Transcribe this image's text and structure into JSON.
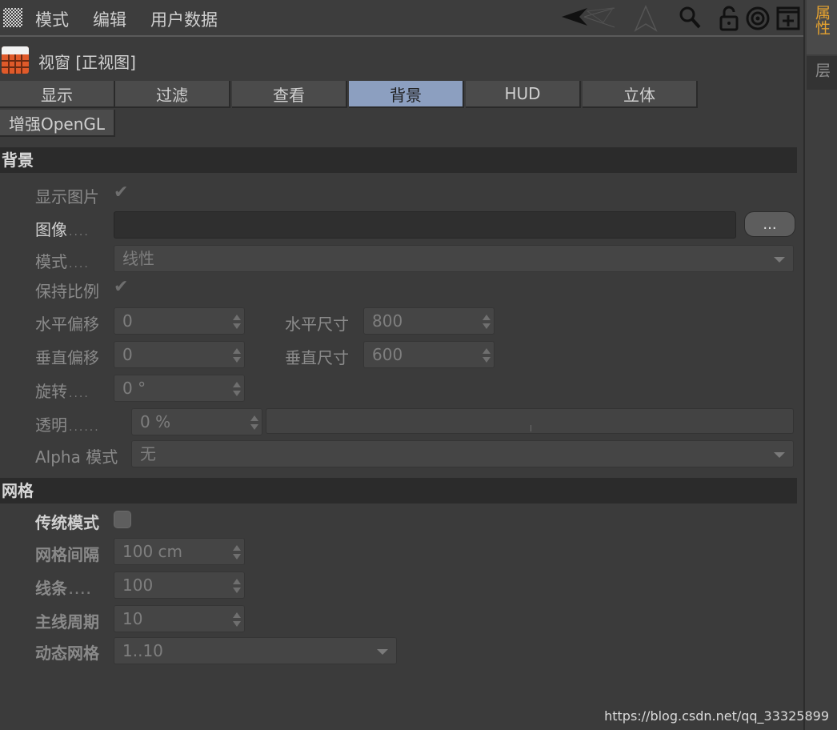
{
  "menu": {
    "items": [
      "模式",
      "编辑",
      "用户数据"
    ]
  },
  "toolbar": {
    "icons": [
      "arrow-back-icon",
      "arrow-up-icon",
      "search-icon",
      "lock-icon",
      "target-icon",
      "add-panel-icon"
    ]
  },
  "title": {
    "text": "视窗 [正视图]"
  },
  "tabs": [
    {
      "label": "显示"
    },
    {
      "label": "过滤"
    },
    {
      "label": "查看"
    },
    {
      "label": "背景",
      "active": true
    },
    {
      "label": "HUD"
    },
    {
      "label": "立体"
    },
    {
      "label": "增强OpenGL"
    }
  ],
  "background": {
    "header": "背景",
    "show_image": {
      "label": "显示图片",
      "checked": true
    },
    "image": {
      "label": "图像",
      "value": "",
      "browse": "..."
    },
    "mode": {
      "label": "模式",
      "value": "线性"
    },
    "keep_ratio": {
      "label": "保持比例",
      "checked": true
    },
    "h_offset": {
      "label": "水平偏移",
      "value": "0"
    },
    "h_size": {
      "label": "水平尺寸",
      "value": "800"
    },
    "v_offset": {
      "label": "垂直偏移",
      "value": "0"
    },
    "v_size": {
      "label": "垂直尺寸",
      "value": "600"
    },
    "rotation": {
      "label": "旋转",
      "value": "0 °"
    },
    "transparency": {
      "label": "透明",
      "value": "0 %",
      "level": 0
    },
    "alpha_mode": {
      "label": "Alpha 模式",
      "value": "无"
    }
  },
  "grid": {
    "header": "网格",
    "legacy": {
      "label": "传统模式",
      "checked": false
    },
    "spacing": {
      "label": "网格间隔",
      "value": "100 cm"
    },
    "lines": {
      "label": "线条",
      "value": "100"
    },
    "major": {
      "label": "主线周期",
      "value": "10"
    },
    "dynamic": {
      "label": "动态网格",
      "value": "1..10"
    }
  },
  "side_tabs": [
    {
      "label": "属性",
      "active": true
    },
    {
      "label": "层"
    }
  ],
  "watermark": "https://blog.csdn.net/qq_33325899",
  "colors": {
    "active_tab": "#8c9fc0",
    "side_tab_active": "#e5a230"
  }
}
